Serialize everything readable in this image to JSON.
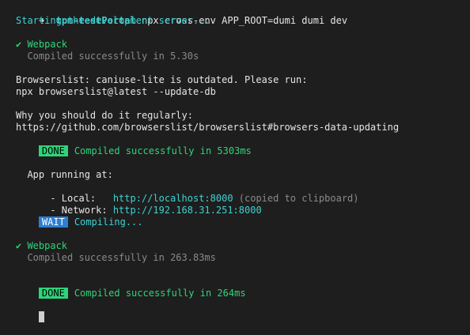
{
  "prompt": {
    "arrow": "➜",
    "dir": "tpm-testPortal",
    "command": " npx cross-env APP_ROOT=dumi dumi dev"
  },
  "starting": "Starting the development server...",
  "webpack1": {
    "check": "✔ Webpack",
    "compiled": "  Compiled successfully in 5.30s"
  },
  "browserslist": {
    "line1": "Browserslist: caniuse-lite is outdated. Please run:",
    "line2": "npx browserslist@latest --update-db",
    "line3": "Why you should do it regularly:",
    "line4": "https://github.com/browserslist/browserslist#browsers-data-updating"
  },
  "done1": {
    "badge": "DONE",
    "text": "Compiled successfully in 5303ms"
  },
  "app": {
    "running": "  App running at:",
    "local_label": "  - Local:   ",
    "local_url": "http://localhost:8000",
    "local_note": " (copied to clipboard)",
    "network_label": "  - Network: ",
    "network_url": "http://192.168.31.251:8000"
  },
  "wait": {
    "badge": "WAIT",
    "text": "Compiling..."
  },
  "webpack2": {
    "check": "✔ Webpack",
    "compiled": "  Compiled successfully in 263.83ms"
  },
  "done2": {
    "badge": "DONE",
    "text": "Compiled successfully in 264ms"
  },
  "colors": {
    "background": "#1e1e1e",
    "cyan": "#3fd1d1",
    "green": "#2fd47a",
    "blue": "#2a7fd4",
    "gray": "#8a8a8a"
  }
}
